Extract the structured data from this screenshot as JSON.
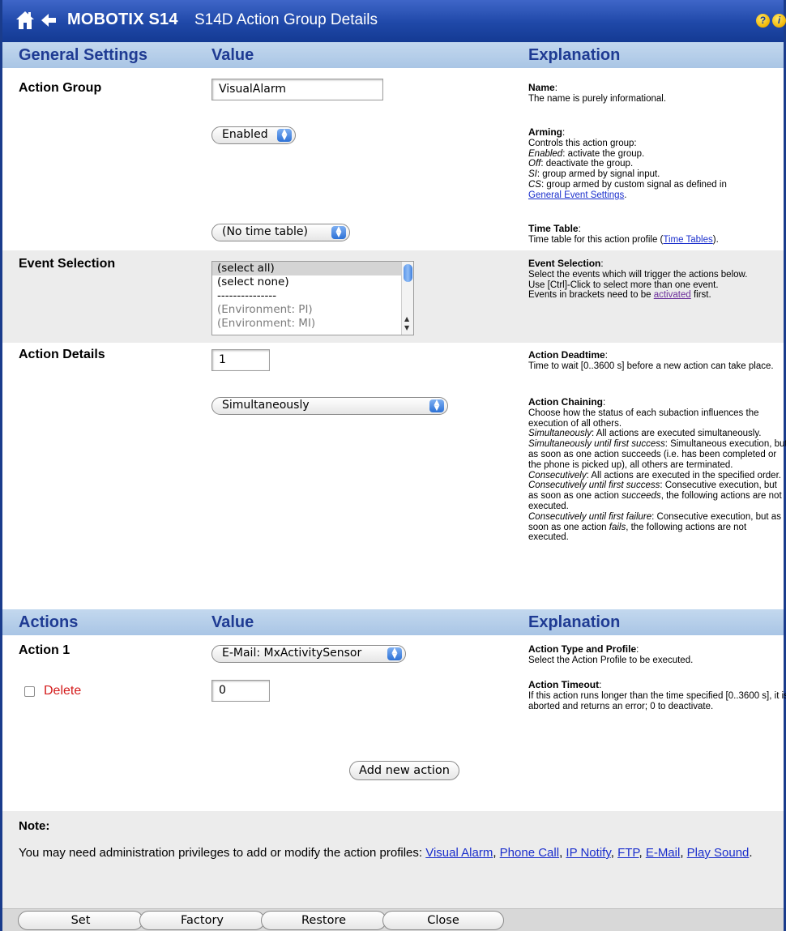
{
  "header": {
    "brand": "MOBOTIX S14",
    "page_title": "S14D Action Group Details",
    "help_glyph": "?",
    "info_glyph": "i"
  },
  "general_section": {
    "col1": "General Settings",
    "col2": "Value",
    "col3": "Explanation"
  },
  "action_group": {
    "label": "Action Group",
    "name_value": "VisualAlarm",
    "name_expl_title": "Name",
    "name_expl_text": "The name is purely informational.",
    "arming_value": "Enabled",
    "arming_expl_title": "Arming",
    "arming_expl_intro": "Controls this action group:",
    "arming_enabled_term": "Enabled",
    "arming_enabled_text": ": activate the group.",
    "arming_off_term": "Off",
    "arming_off_text": ": deactivate the group.",
    "arming_si_term": "SI",
    "arming_si_text": ": group armed by signal input.",
    "arming_cs_term": "CS",
    "arming_cs_text": ": group armed by custom signal as defined in",
    "arming_link": "General Event Settings",
    "timetable_value": "(No time table)",
    "timetable_expl_title": "Time Table",
    "timetable_expl_text": "Time table for this action profile (",
    "timetable_link": "Time Tables",
    "timetable_expl_end": ")."
  },
  "event_selection": {
    "label": "Event Selection",
    "options": [
      "(select all)",
      "(select none)",
      "---------------",
      "(Environment: PI)",
      "(Environment: MI)"
    ],
    "expl_title": "Event Selection",
    "expl_line1": "Select the events which will trigger the actions below.",
    "expl_line2": "Use [Ctrl]-Click to select more than one event.",
    "expl_line3": "Events in brackets need to be ",
    "expl_link": "activated",
    "expl_line3_end": " first."
  },
  "action_details": {
    "label": "Action Details",
    "deadtime_value": "1",
    "deadtime_expl_title": "Action Deadtime",
    "deadtime_expl_text": "Time to wait [0..3600 s] before a new action can take place.",
    "chaining_value": "Simultaneously",
    "chaining_expl_title": "Action Chaining",
    "chaining_intro": "Choose how the status of each subaction influences the execution of all others.",
    "sim_term": "Simultaneously",
    "sim_text": ": All actions are executed simultaneously.",
    "simfs_term": "Simultaneously until first success",
    "simfs_text": ": Simultaneous execution, but as soon as one action succeeds (i.e. has been completed or the phone is picked up), all others are terminated.",
    "con_term": "Consecutively",
    "con_text": ": All actions are executed in the specified order.",
    "confs_term": "Consecutively until first success",
    "confs_text_a": ": Consecutive execution, but as soon as one action ",
    "confs_em": "succeeds",
    "confs_text_b": ", the following actions are not executed.",
    "conff_term": "Consecutively until first failure",
    "conff_text_a": ": Consecutive execution, but as soon as one action ",
    "conff_em": "fails",
    "conff_text_b": ", the following actions are not executed."
  },
  "actions_section": {
    "col1": "Actions",
    "col2": "Value",
    "col3": "Explanation"
  },
  "action1": {
    "label": "Action 1",
    "profile_value": "E-Mail: MxActivitySensor",
    "profile_expl_title": "Action Type and Profile",
    "profile_expl_text": "Select the Action Profile to be executed.",
    "delete_label": "Delete",
    "timeout_value": "0",
    "timeout_expl_title": "Action Timeout",
    "timeout_expl_text": "If this action runs longer than the time specified [0..3600 s], it is aborted and returns an error; 0 to deactivate.",
    "add_button": "Add new action"
  },
  "note": {
    "title": "Note:",
    "text": "You may need administration privileges to add or modify the action profiles: ",
    "links": [
      "Visual Alarm",
      "Phone Call",
      "IP Notify",
      "FTP",
      "E-Mail",
      "Play Sound"
    ],
    "sep": ", ",
    "end": "."
  },
  "footer": {
    "set": "Set",
    "factory": "Factory",
    "restore": "Restore",
    "close": "Close"
  },
  "colors": {
    "title_bar": "#1f48a8",
    "section_header_bg": "#b6cfeb",
    "section_header_text": "#1f3b93",
    "delete_red": "#d41b1b",
    "link_blue": "#1a2ecc"
  }
}
